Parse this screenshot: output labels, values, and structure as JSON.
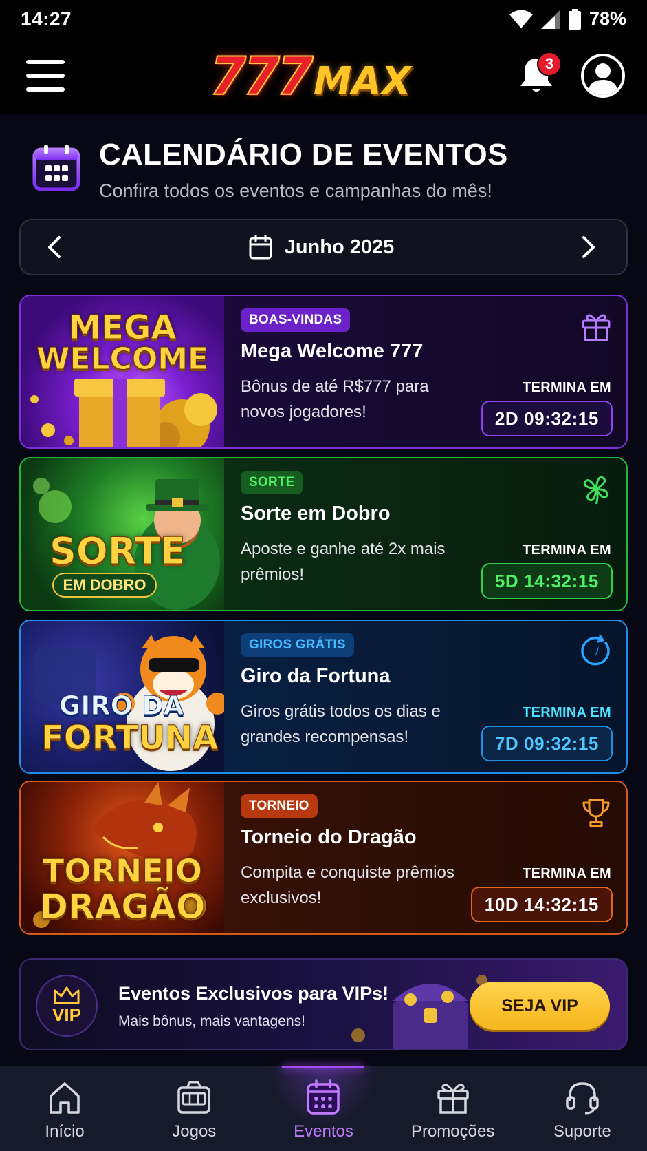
{
  "status_bar": {
    "time": "14:27",
    "battery": "78%"
  },
  "header": {
    "logo_777": "777",
    "logo_max": "MAX",
    "notification_count": "3"
  },
  "page": {
    "title": "CALENDÁRIO DE EVENTOS",
    "subtitle": "Confira todos os eventos e campanhas do mês!"
  },
  "month_selector": {
    "label": "Junho 2025"
  },
  "events": [
    {
      "art_line1": "MEGA",
      "art_line2": "WELCOME",
      "tag": "BOAS-VINDAS",
      "title": "Mega Welcome 777",
      "description": "Bônus de até R$777 para novos jogadores!",
      "ends_label": "TERMINA EM",
      "countdown": "2D 09:32:15",
      "icon": "gift-icon",
      "accent": "#8f3cff"
    },
    {
      "art_line1": "SORTE",
      "art_line2": "EM DOBRO",
      "tag": "SORTE",
      "title": "Sorte em Dobro",
      "description": "Aposte e ganhe até 2x mais prêmios!",
      "ends_label": "TERMINA EM",
      "countdown": "5D 14:32:15",
      "icon": "clover-icon",
      "accent": "#2fd04a"
    },
    {
      "art_line1": "GIRO DA",
      "art_line2": "FORTUNA",
      "tag": "GIROS GRÁTIS",
      "title": "Giro da Fortuna",
      "description": "Giros grátis todos os dias e grandes recompensas!",
      "ends_label": "TERMINA EM",
      "countdown": "7D 09:32:15",
      "icon": "spin-icon",
      "accent": "#1e9bf0"
    },
    {
      "art_line1": "TORNEIO",
      "art_line2": "DRAGÃO",
      "tag": "TORNEIO",
      "title": "Torneio do Dragão",
      "description": "Compita e conquiste prêmios exclusivos!",
      "ends_label": "TERMINA EM",
      "countdown": "10D 14:32:15",
      "icon": "trophy-icon",
      "accent": "#e0651c"
    }
  ],
  "vip_banner": {
    "badge": "VIP",
    "title": "Eventos Exclusivos para VIPs!",
    "subtitle": "Mais bônus, mais vantagens!",
    "button": "SEJA VIP"
  },
  "bottom_nav": [
    {
      "label": "Início",
      "icon": "home-icon"
    },
    {
      "label": "Jogos",
      "icon": "slot-machine-icon"
    },
    {
      "label": "Eventos",
      "icon": "calendar-icon",
      "active": true
    },
    {
      "label": "Promoções",
      "icon": "gift-icon"
    },
    {
      "label": "Suporte",
      "icon": "headset-icon"
    }
  ],
  "colors": {
    "background": "#080814",
    "accent_purple": "#a34cff",
    "gold": "#ffc425",
    "badge_red": "#e21b2d"
  }
}
